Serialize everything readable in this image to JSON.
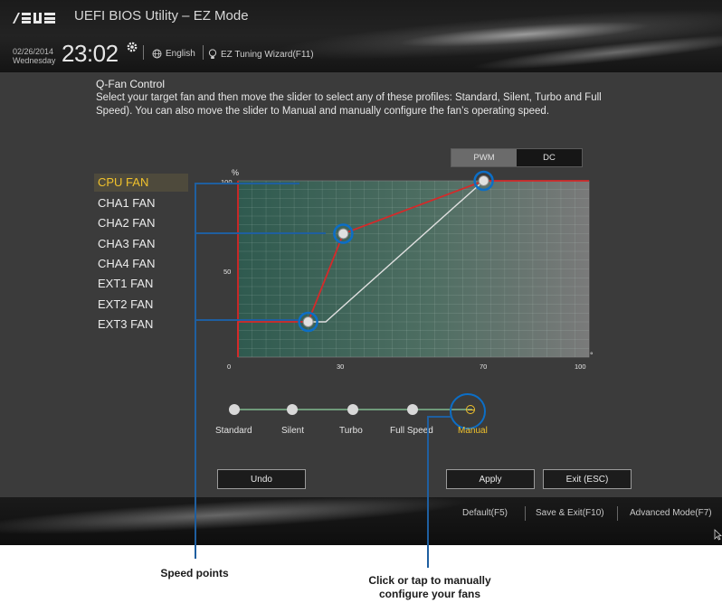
{
  "header": {
    "app_title": "UEFI BIOS Utility – EZ Mode",
    "date": "02/26/2014",
    "weekday": "Wednesday",
    "time": "23:02",
    "language": "English",
    "tuning_wizard": "EZ Tuning Wizard(F11)"
  },
  "qfan": {
    "title": "Q-Fan Control",
    "description": "Select your target fan and then move the slider to select any of these profiles: Standard, Silent, Turbo and Full Speed). You can also move the slider to Manual and manually configure the fan’s operating speed."
  },
  "fans": [
    {
      "label": "CPU FAN",
      "selected": true
    },
    {
      "label": "CHA1 FAN",
      "selected": false
    },
    {
      "label": "CHA2 FAN",
      "selected": false
    },
    {
      "label": "CHA3 FAN",
      "selected": false
    },
    {
      "label": "CHA4 FAN",
      "selected": false
    },
    {
      "label": "EXT1 FAN",
      "selected": false
    },
    {
      "label": "EXT2 FAN",
      "selected": false
    },
    {
      "label": "EXT3 FAN",
      "selected": false
    }
  ],
  "mode_toggle": {
    "pwm": "PWM",
    "dc": "DC",
    "selected": "PWM"
  },
  "graph": {
    "y_unit": "%",
    "x_unit": "°C",
    "y_ticks": [
      "0",
      "50",
      "100"
    ],
    "x_ticks": [
      "0",
      "30",
      "70",
      "100"
    ],
    "manual_curve": [
      [
        20,
        20
      ],
      [
        30,
        70
      ],
      [
        70,
        100
      ]
    ],
    "reference_curve": [
      [
        20,
        20
      ],
      [
        25,
        20
      ],
      [
        70,
        100
      ]
    ],
    "colors": {
      "manual_curve": "#d42a2a",
      "reference_curve": "#e0e0e0",
      "point_ring": "#0c6ec6",
      "grid_fill": "#3f6f60"
    }
  },
  "profiles": {
    "items": [
      "Standard",
      "Silent",
      "Turbo",
      "Full Speed",
      "Manual"
    ],
    "selected": "Manual",
    "selected_color": "#f1c22c"
  },
  "buttons": {
    "undo": "Undo",
    "apply": "Apply",
    "exit": "Exit (ESC)"
  },
  "footer": {
    "default": "Default(F5)",
    "save_exit": "Save & Exit(F10)",
    "advanced": "Advanced Mode(F7)"
  },
  "callouts": {
    "speed_points": "Speed points",
    "manual": "Click or tap to manually configure your fans"
  }
}
